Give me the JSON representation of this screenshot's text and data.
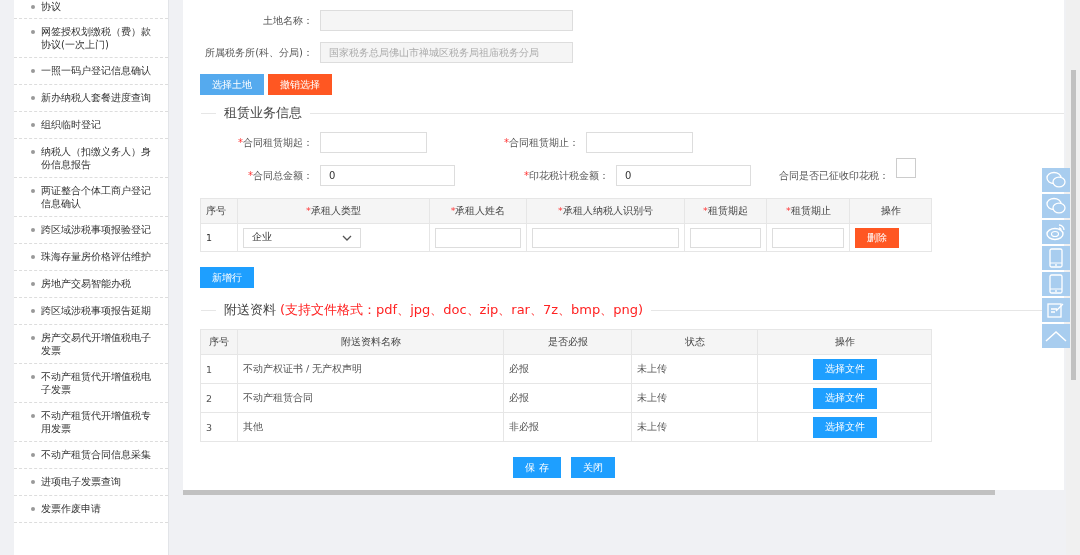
{
  "sidebar": {
    "items": [
      {
        "label": "协议"
      },
      {
        "label": "网签授权划缴税（费）款协议(一次上门)"
      },
      {
        "label": "一照一码户登记信息确认"
      },
      {
        "label": "新办纳税人套餐进度查询"
      },
      {
        "label": "组织临时登记"
      },
      {
        "label": "纳税人（扣缴义务人）身份信息报告"
      },
      {
        "label": "两证整合个体工商户登记信息确认"
      },
      {
        "label": "跨区域涉税事项报验登记"
      },
      {
        "label": "珠海存量房价格评估维护"
      },
      {
        "label": "房地产交易智能办税"
      },
      {
        "label": "跨区域涉税事项报告延期"
      },
      {
        "label": "房产交易代开增值税电子发票"
      },
      {
        "label": "不动产租赁代开增值税电子发票"
      },
      {
        "label": "不动产租赁代开增值税专用发票"
      },
      {
        "label": "不动产租赁合同信息采集"
      },
      {
        "label": "进项电子发票查询"
      },
      {
        "label": "发票作废申请"
      }
    ]
  },
  "land": {
    "fields": [
      {
        "label": "土地名称："
      },
      {
        "label": "所属税务所(科、分局)：",
        "value": "国家税务总局佛山市禅城区税务局祖庙税务分局"
      }
    ],
    "buttons": [
      {
        "label": "选择土地",
        "kind": "primary"
      },
      {
        "label": "撤销选择",
        "kind": "danger"
      }
    ]
  },
  "lease": {
    "title": "租赁业务信息",
    "rows": [
      [
        {
          "mark": "*",
          "label": "合同租赁期起："
        },
        {
          "mark": "*",
          "label": "合同租赁期止："
        }
      ],
      [
        {
          "mark": "*",
          "label": "合同总金额：",
          "value": "0"
        },
        {
          "mark": "*",
          "label": "印花税计税金额：",
          "value": "0"
        }
      ]
    ],
    "stamp_check": {
      "label": "合同是否已征收印花税：",
      "checked": false
    },
    "table": {
      "columns": [
        {
          "label": "序号"
        },
        {
          "mark": "*",
          "label": "承租人类型"
        },
        {
          "mark": "*",
          "label": "承租人姓名"
        },
        {
          "mark": "*",
          "label": "承租人纳税人识别号"
        },
        {
          "mark": "*",
          "label": "租赁期起"
        },
        {
          "mark": "*",
          "label": "租赁期止"
        },
        {
          "label": "操作"
        }
      ],
      "rows": [
        {
          "no": "1",
          "type": "企业",
          "action": "删除"
        }
      ]
    },
    "add_button": "新增行"
  },
  "attachments": {
    "title": "附送资料",
    "hint": "(支持文件格式：pdf、jpg、doc、zip、rar、7z、bmp、png)",
    "columns": [
      "序号",
      "附送资料名称",
      "是否必报",
      "状态",
      "操作"
    ],
    "rows": [
      {
        "no": "1",
        "name": "不动产权证书 / 无产权声明",
        "required": "必报",
        "status": "未上传",
        "action": "选择文件"
      },
      {
        "no": "2",
        "name": "不动产租赁合同",
        "required": "必报",
        "status": "未上传",
        "action": "选择文件"
      },
      {
        "no": "3",
        "name": "其他",
        "required": "非必报",
        "status": "未上传",
        "action": "选择文件"
      }
    ]
  },
  "footer_buttons": [
    "保 存",
    "关闭"
  ],
  "float_bar": [
    {
      "kind": "wechat"
    },
    {
      "kind": "wechat"
    },
    {
      "kind": "weibo"
    },
    {
      "kind": "phone"
    },
    {
      "kind": "phone"
    },
    {
      "kind": "edit"
    },
    {
      "kind": "top"
    }
  ]
}
